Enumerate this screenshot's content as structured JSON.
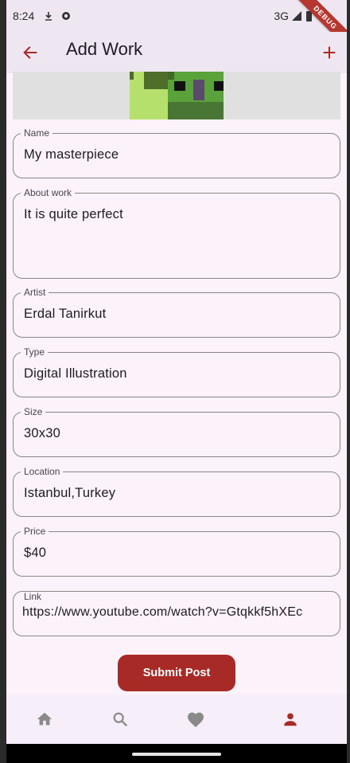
{
  "status_bar": {
    "time": "8:24",
    "network": "3G"
  },
  "debug_banner": "DEBUG",
  "app_bar": {
    "title": "Add Work",
    "back_icon": "arrow-back-icon",
    "add_icon": "plus-icon"
  },
  "form": {
    "name": {
      "label": "Name",
      "value": "My masterpiece"
    },
    "about": {
      "label": "About work",
      "value": "It is quite perfect"
    },
    "artist": {
      "label": "Artist",
      "value": "Erdal Tanirkut"
    },
    "type": {
      "label": "Type",
      "value": "Digital Illustration"
    },
    "size": {
      "label": "Size",
      "value": "30x30"
    },
    "location": {
      "label": "Location",
      "value": "Istanbul,Turkey"
    },
    "price": {
      "label": "Price",
      "value": "$40"
    },
    "link": {
      "label": "Link",
      "value": "https://www.youtube.com/watch?v=Gtqkkf5hXEc"
    }
  },
  "submit_label": "Submit Post",
  "bottom_nav": {
    "items": [
      {
        "icon": "home-icon",
        "active": false
      },
      {
        "icon": "search-icon",
        "active": false
      },
      {
        "icon": "heart-icon",
        "active": false
      },
      {
        "icon": "person-icon",
        "active": true
      }
    ]
  },
  "colors": {
    "accent": "#a72a26",
    "background": "#fbf2fa",
    "app_bar": "#eee6f1",
    "inactive_icon": "#8a8a8a"
  }
}
